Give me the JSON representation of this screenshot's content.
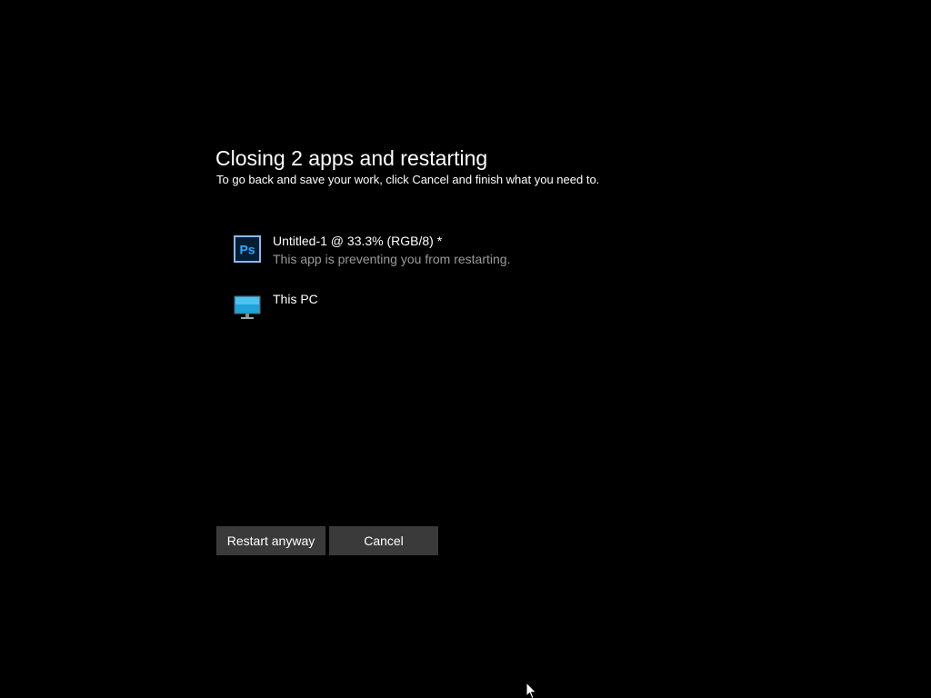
{
  "dialog": {
    "title": "Closing 2 apps and restarting",
    "subtitle": "To go back and save your work, click Cancel and finish what you need to."
  },
  "apps": [
    {
      "name": "Untitled-1 @ 33.3% (RGB/8) *",
      "status": "This app is preventing you from restarting.",
      "icon": "photoshop-icon",
      "icon_text": "Ps"
    },
    {
      "name": "This PC",
      "status": "",
      "icon": "monitor-icon"
    }
  ],
  "buttons": {
    "restart_label": "Restart anyway",
    "cancel_label": "Cancel"
  },
  "colors": {
    "background": "#000000",
    "text": "#ffffff",
    "status_text": "#9a9a9a",
    "button_bg": "#3a3a3a",
    "photoshop_bg": "#001d34",
    "photoshop_accent": "#31a8ff",
    "monitor_screen": "#1fa3d8"
  }
}
